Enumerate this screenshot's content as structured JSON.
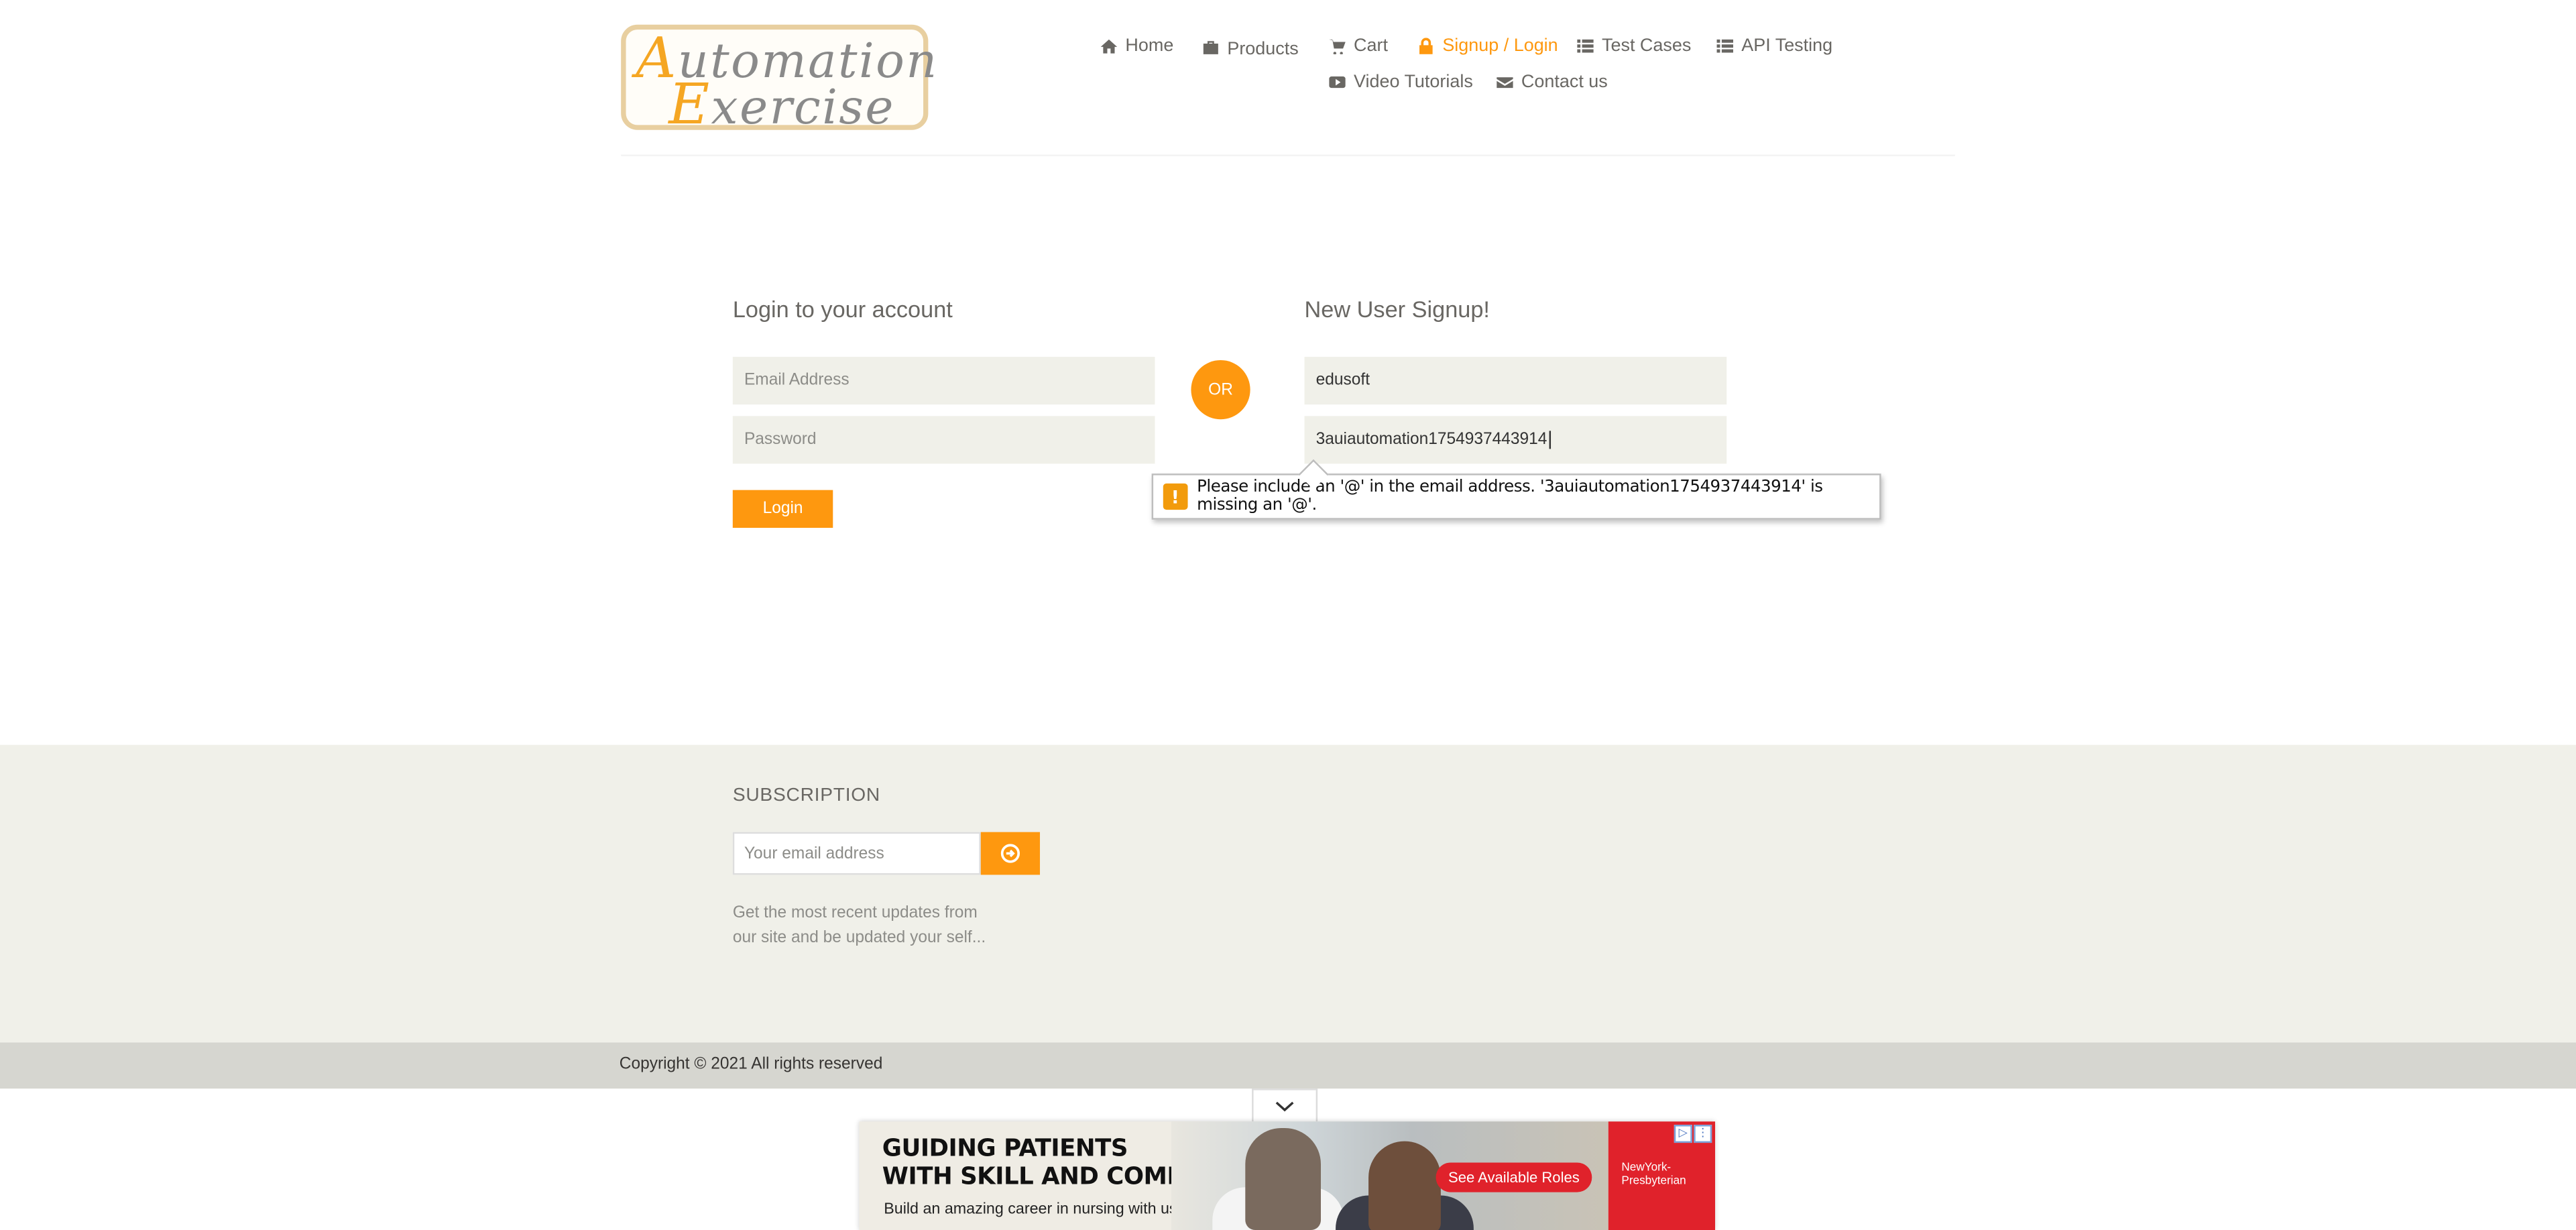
{
  "header": {
    "logo": {
      "line1_cap": "A",
      "line1_rest": "utomation",
      "line2_cap": "E",
      "line2_rest": "xercise"
    },
    "nav": [
      {
        "label": "Home",
        "icon": "home-icon"
      },
      {
        "label": "Products",
        "icon": "products-icon"
      },
      {
        "label": "Cart",
        "icon": "cart-icon"
      },
      {
        "label": "Signup / Login",
        "icon": "lock-icon",
        "active": true
      },
      {
        "label": "Test Cases",
        "icon": "list-icon"
      },
      {
        "label": "API Testing",
        "icon": "list-icon"
      },
      {
        "label": "Video Tutorials",
        "icon": "youtube-icon"
      },
      {
        "label": "Contact us",
        "icon": "envelope-icon"
      }
    ]
  },
  "login": {
    "title": "Login to your account",
    "email_placeholder": "Email Address",
    "password_placeholder": "Password",
    "button": "Login"
  },
  "or_label": "OR",
  "signup": {
    "title": "New User Signup!",
    "name_value": "edusoft",
    "email_value": "3auiautomation1754937443914"
  },
  "validation_tooltip": {
    "icon": "warning-icon",
    "message": "Please include an '@' in the email address. '3auiautomation1754937443914' is missing an '@'."
  },
  "footer": {
    "subscription_title": "SUBSCRIPTION",
    "subscription_placeholder": "Your email address",
    "subscription_text_line1": "Get the most recent updates from",
    "subscription_text_line2": "our site and be updated your self...",
    "copyright": "Copyright © 2021 All rights reserved"
  },
  "ad": {
    "headline_line1": "GUIDING PATIENTS",
    "headline_line2": "WITH SKILL AND COMPASSION.",
    "subline": "Build an amazing career in nursing with us.",
    "cta": "See Available Roles",
    "brand_line1": "NewYork-",
    "brand_line2": "Presbyterian"
  },
  "colors": {
    "accent": "#fe980f",
    "field_bg": "#f0f0e9",
    "footer_bg": "#f0f0e9",
    "footer_bottom": "#d6d6d0",
    "text": "#696763"
  }
}
